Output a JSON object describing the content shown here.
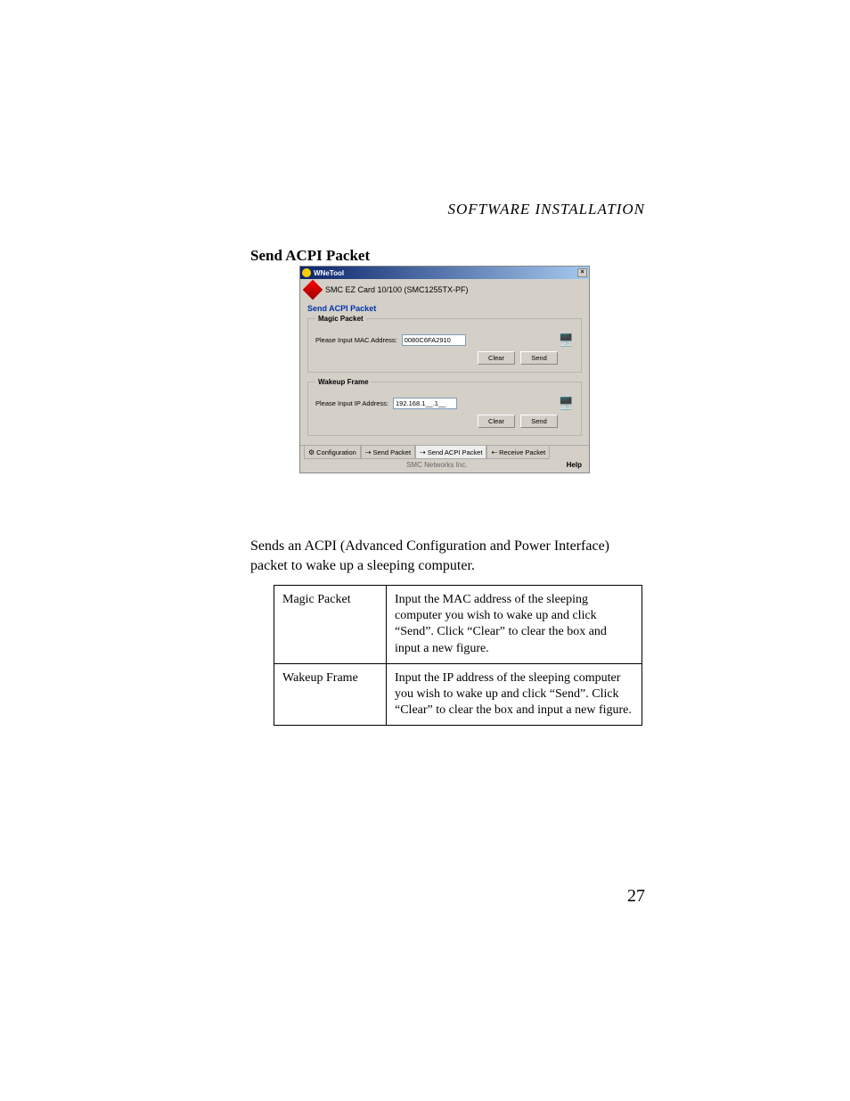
{
  "header": {
    "section": "SOFTWARE INSTALLATION"
  },
  "heading": "Send ACPI Packet",
  "screenshot": {
    "window_title": "WNeTool",
    "close_glyph": "×",
    "card_title": "SMC EZ Card 10/100 (SMC1255TX-PF)",
    "panel_title": "Send ACPI Packet",
    "magic_packet": {
      "legend": "Magic Packet",
      "label": "Please Input MAC Address:",
      "value": "0080C6FA2910",
      "clear": "Clear",
      "send": "Send"
    },
    "wakeup_frame": {
      "legend": "Wakeup Frame",
      "label": "Please Input IP Address:",
      "value": "192.168.1__.1__",
      "clear": "Clear",
      "send": "Send"
    },
    "tabs": {
      "configuration": "Configuration",
      "send_packet": "Send Packet",
      "send_acpi": "Send ACPI Packet",
      "receive": "Receive Packet"
    },
    "footer_company": "SMC Networks Inc.",
    "help": "Help"
  },
  "body_para": "Sends an ACPI (Advanced Configuration and Power Interface) packet to wake up a sleeping computer.",
  "table": {
    "rows": [
      {
        "name": "Magic Packet",
        "desc": "Input the MAC address of the sleeping computer you wish to wake up and click “Send”. Click “Clear” to clear the box and input a new figure."
      },
      {
        "name": "Wakeup Frame",
        "desc": "Input the IP address of the sleeping computer you wish to wake up and click “Send”. Click “Clear” to clear the box and input a new figure."
      }
    ]
  },
  "page_number": "27"
}
